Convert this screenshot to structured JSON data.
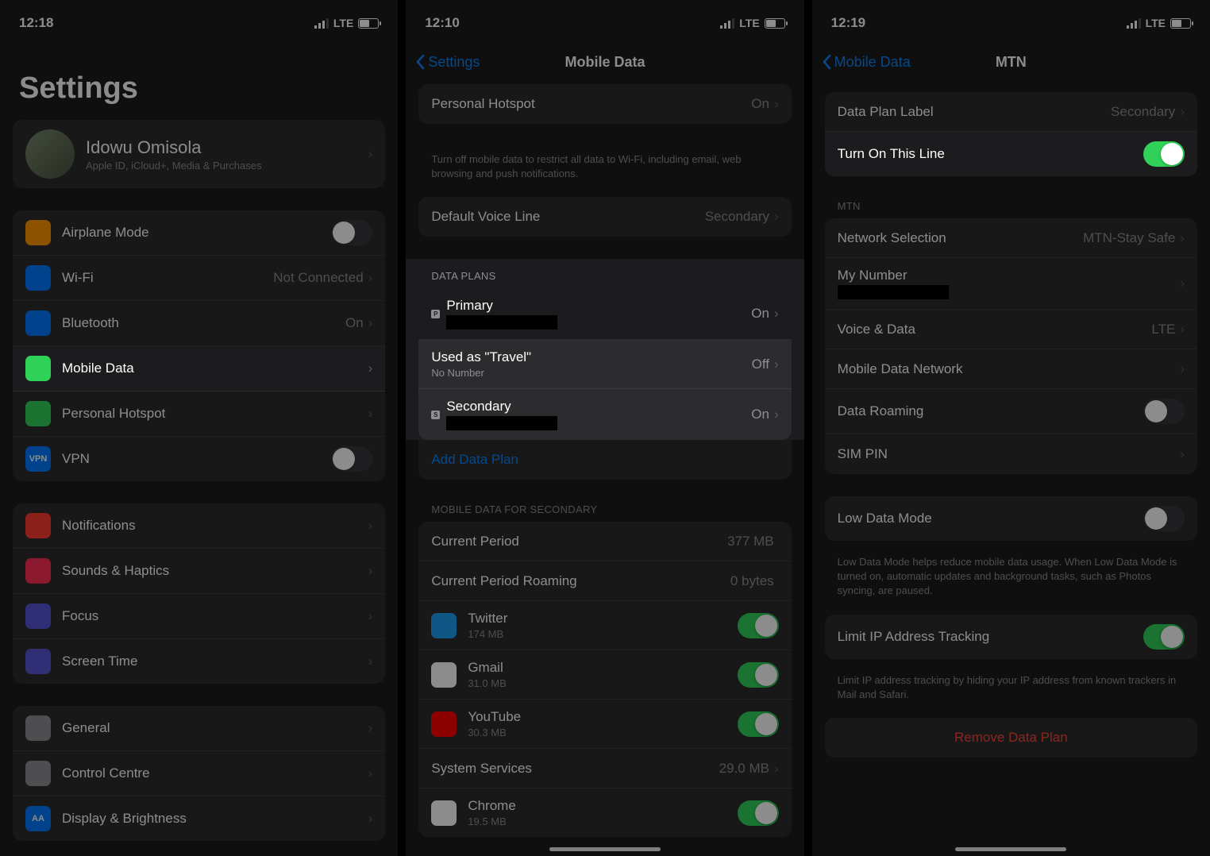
{
  "panel1": {
    "time": "12:18",
    "carrier": "LTE",
    "title": "Settings",
    "profile": {
      "name": "Idowu Omisola",
      "sub": "Apple ID, iCloud+, Media & Purchases"
    },
    "items1": [
      {
        "icon": "airplane-icon",
        "color": "#ff9500",
        "label": "Airplane Mode",
        "type": "toggle",
        "on": false
      },
      {
        "icon": "wifi-icon",
        "color": "#007aff",
        "label": "Wi-Fi",
        "value": "Not Connected"
      },
      {
        "icon": "bluetooth-icon",
        "color": "#007aff",
        "label": "Bluetooth",
        "value": "On"
      },
      {
        "icon": "antenna-icon",
        "color": "#30d158",
        "label": "Mobile Data",
        "highlight": true
      },
      {
        "icon": "hotspot-icon",
        "color": "#30d158",
        "label": "Personal Hotspot"
      },
      {
        "icon": "vpn-icon",
        "color": "#007aff",
        "label": "VPN",
        "type": "toggle",
        "on": false,
        "badge": "VPN"
      }
    ],
    "items2": [
      {
        "icon": "bell-icon",
        "color": "#ff3b30",
        "label": "Notifications"
      },
      {
        "icon": "speaker-icon",
        "color": "#ff2d55",
        "label": "Sounds & Haptics"
      },
      {
        "icon": "moon-icon",
        "color": "#5856d6",
        "label": "Focus"
      },
      {
        "icon": "hourglass-icon",
        "color": "#5856d6",
        "label": "Screen Time"
      }
    ],
    "items3": [
      {
        "icon": "gear-icon",
        "color": "#8e8e93",
        "label": "General"
      },
      {
        "icon": "switches-icon",
        "color": "#8e8e93",
        "label": "Control Centre"
      },
      {
        "icon": "display-icon",
        "color": "#007aff",
        "label": "Display & Brightness",
        "badge": "AA"
      }
    ]
  },
  "panel2": {
    "time": "12:10",
    "carrier": "LTE",
    "back": "Settings",
    "title": "Mobile Data",
    "top": [
      {
        "label": "Personal Hotspot",
        "value": "On"
      }
    ],
    "top_footer": "Turn off mobile data to restrict all data to Wi-Fi, including email, web browsing and push notifications.",
    "voice": [
      {
        "label": "Default Voice Line",
        "value": "Secondary"
      }
    ],
    "plans_header": "DATA PLANS",
    "plans": [
      {
        "badge": "P",
        "label": "Primary",
        "value": "On",
        "highlight": true,
        "redact": true
      },
      {
        "label": "Used as \"Travel\"",
        "sub": "No Number",
        "value": "Off"
      },
      {
        "badge": "S",
        "label": "Secondary",
        "value": "On",
        "redact": true
      }
    ],
    "add_plan": "Add Data Plan",
    "usage_header": "MOBILE DATA FOR SECONDARY",
    "usage_summary": [
      {
        "label": "Current Period",
        "value": "377 MB"
      },
      {
        "label": "Current Period Roaming",
        "value": "0 bytes"
      }
    ],
    "apps": [
      {
        "icon": "twitter-icon",
        "color": "#1da1f2",
        "label": "Twitter",
        "sub": "174 MB",
        "on": true
      },
      {
        "icon": "gmail-icon",
        "color": "#fff",
        "label": "Gmail",
        "sub": "31.0 MB",
        "on": true,
        "gradient": true
      },
      {
        "icon": "youtube-icon",
        "color": "#ff0000",
        "label": "YouTube",
        "sub": "30.3 MB",
        "on": true
      },
      {
        "label": "System Services",
        "value": "29.0 MB"
      },
      {
        "icon": "chrome-icon",
        "color": "#fff",
        "label": "Chrome",
        "sub": "19.5 MB",
        "on": true,
        "gradient": true
      }
    ]
  },
  "panel3": {
    "time": "12:19",
    "carrier": "LTE",
    "back": "Mobile Data",
    "title": "MTN",
    "g1": [
      {
        "label": "Data Plan Label",
        "value": "Secondary"
      },
      {
        "label": "Turn On This Line",
        "type": "toggle",
        "on": true,
        "highlight": true
      }
    ],
    "g2_header": "MTN",
    "g2": [
      {
        "label": "Network Selection",
        "value": "MTN-Stay Safe"
      },
      {
        "label": "My Number",
        "redact": true
      },
      {
        "label": "Voice & Data",
        "value": "LTE"
      },
      {
        "label": "Mobile Data Network"
      },
      {
        "label": "Data Roaming",
        "type": "toggle",
        "on": false
      },
      {
        "label": "SIM PIN"
      }
    ],
    "g3": [
      {
        "label": "Low Data Mode",
        "type": "toggle",
        "on": false
      }
    ],
    "g3_footer": "Low Data Mode helps reduce mobile data usage. When Low Data Mode is turned on, automatic updates and background tasks, such as Photos syncing, are paused.",
    "g4": [
      {
        "label": "Limit IP Address Tracking",
        "type": "toggle",
        "on": true
      }
    ],
    "g4_footer": "Limit IP address tracking by hiding your IP address from known trackers in Mail and Safari.",
    "remove": "Remove Data Plan"
  }
}
